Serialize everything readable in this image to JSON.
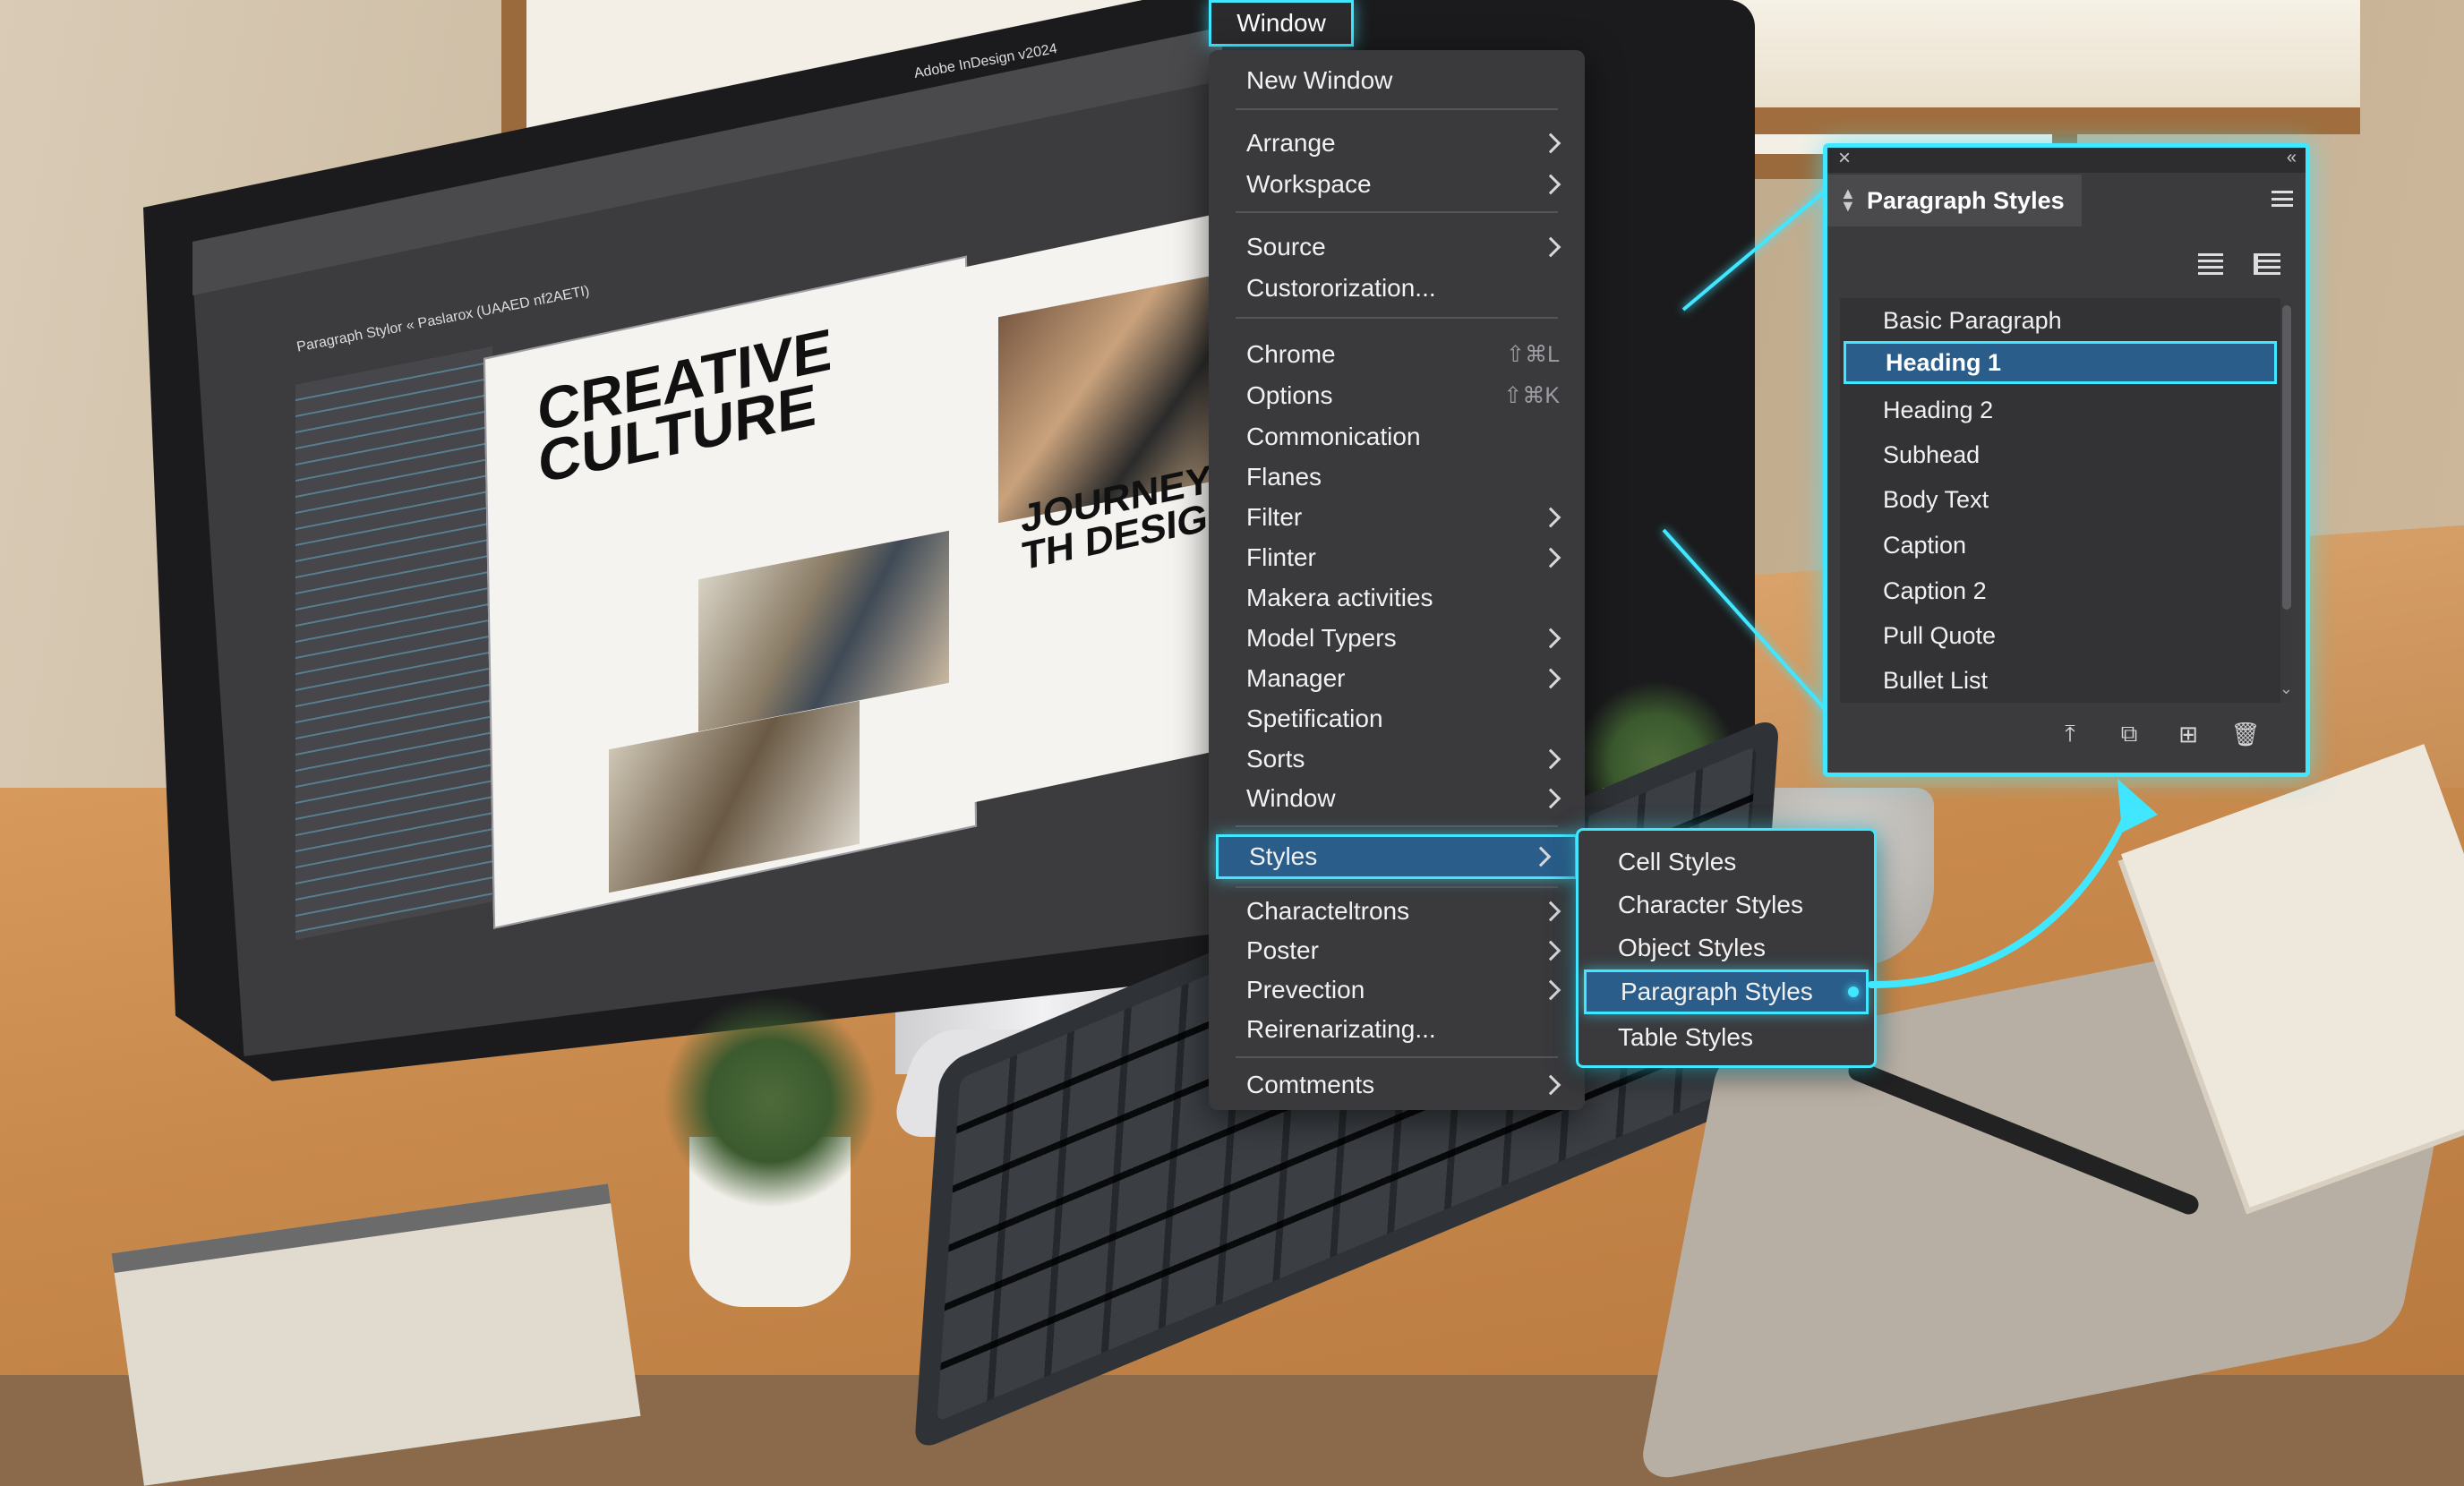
{
  "app_title": "Adobe InDesign v2024",
  "document_tab": "Paragraph Stylor « Paslarox (UAAED nf2AETI)",
  "article": {
    "headline": "CREATIVE CULTURE",
    "headline2": "JOURNEY TH DESIGN"
  },
  "menubar": {
    "active_menu": "Window"
  },
  "window_menu": {
    "items": [
      {
        "label": "New Window",
        "submenu": false,
        "shortcut": ""
      },
      {
        "label": "Arrange",
        "submenu": true,
        "shortcut": ""
      },
      {
        "label": "Workspace",
        "submenu": true,
        "shortcut": ""
      },
      {
        "label": "Source",
        "submenu": true,
        "shortcut": ""
      },
      {
        "label": "Custororization...",
        "submenu": false,
        "shortcut": ""
      },
      {
        "label": "Chrome",
        "submenu": false,
        "shortcut": "⇧⌘L"
      },
      {
        "label": "Options",
        "submenu": false,
        "shortcut": "⇧⌘K"
      },
      {
        "label": "Commonication",
        "submenu": false,
        "shortcut": ""
      },
      {
        "label": "Flanes",
        "submenu": false,
        "shortcut": ""
      },
      {
        "label": "Filter",
        "submenu": true,
        "shortcut": ""
      },
      {
        "label": "Flinter",
        "submenu": true,
        "shortcut": ""
      },
      {
        "label": "Makera activities",
        "submenu": false,
        "shortcut": ""
      },
      {
        "label": "Model Typers",
        "submenu": true,
        "shortcut": ""
      },
      {
        "label": "Manager",
        "submenu": true,
        "shortcut": ""
      },
      {
        "label": "Spetification",
        "submenu": false,
        "shortcut": ""
      },
      {
        "label": "Sorts",
        "submenu": true,
        "shortcut": ""
      },
      {
        "label": "Window",
        "submenu": true,
        "shortcut": ""
      },
      {
        "label": "Styles",
        "submenu": true,
        "shortcut": "",
        "highlighted": true
      },
      {
        "label": "Characteltrons",
        "submenu": true,
        "shortcut": ""
      },
      {
        "label": "Poster",
        "submenu": true,
        "shortcut": ""
      },
      {
        "label": "Prevection",
        "submenu": true,
        "shortcut": ""
      },
      {
        "label": "Reirenarizating...",
        "submenu": false,
        "shortcut": ""
      },
      {
        "label": "Comtments",
        "submenu": true,
        "shortcut": ""
      }
    ]
  },
  "styles_submenu": {
    "items": [
      {
        "label": "Cell Styles"
      },
      {
        "label": "Character Styles"
      },
      {
        "label": "Object Styles"
      },
      {
        "label": "Paragraph Styles",
        "highlighted": true
      },
      {
        "label": "Table Styles"
      }
    ]
  },
  "paragraph_styles_panel": {
    "title": "Paragraph Styles",
    "close_glyph": "×",
    "collapse_glyph": "«",
    "styles": [
      {
        "label": "Basic Paragraph"
      },
      {
        "label": "Heading 1",
        "selected": true
      },
      {
        "label": "Heading 2"
      },
      {
        "label": "Subhead"
      },
      {
        "label": "Body Text"
      },
      {
        "label": "Caption"
      },
      {
        "label": "Caption 2"
      },
      {
        "label": "Pull Quote"
      },
      {
        "label": "Bullet List"
      }
    ],
    "bottom_icons": [
      "style-group-icon",
      "duplicate-style-icon",
      "new-style-icon",
      "trash-icon"
    ]
  },
  "colors": {
    "accent_glow": "#41e6ff",
    "highlight_bg": "#2a5d8a",
    "menu_bg": "#3a3a3d"
  }
}
